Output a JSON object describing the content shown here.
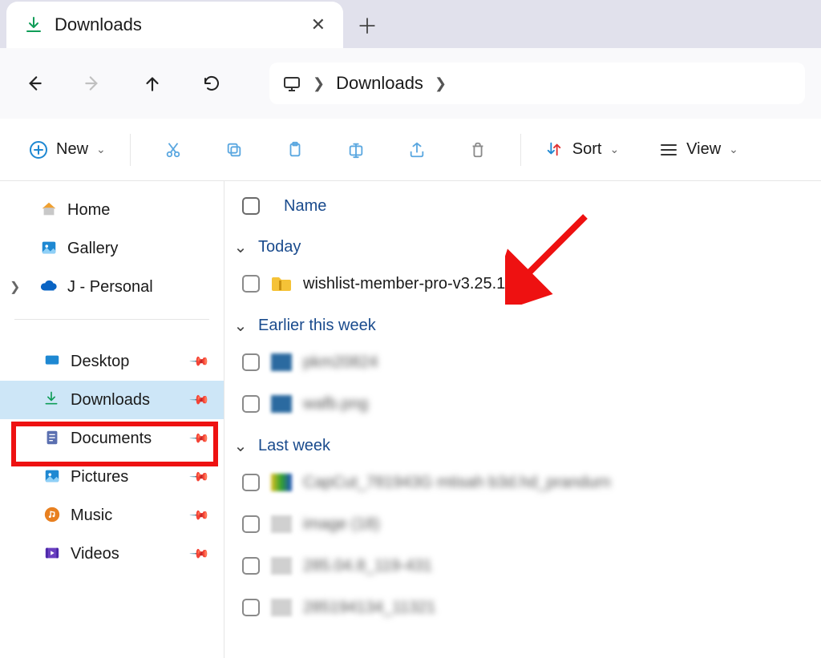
{
  "tab": {
    "title": "Downloads"
  },
  "nav": {},
  "breadcrumb": {
    "current": "Downloads"
  },
  "toolbar": {
    "new_label": "New",
    "sort_label": "Sort",
    "view_label": "View"
  },
  "sidebar": {
    "top": [
      {
        "label": "Home"
      },
      {
        "label": "Gallery"
      },
      {
        "label": "J - Personal"
      }
    ],
    "quick": [
      {
        "label": "Desktop"
      },
      {
        "label": "Downloads",
        "selected": true
      },
      {
        "label": "Documents"
      },
      {
        "label": "Pictures"
      },
      {
        "label": "Music"
      },
      {
        "label": "Videos"
      }
    ]
  },
  "columns": {
    "name": "Name"
  },
  "groups": {
    "today": {
      "label": "Today",
      "items": [
        {
          "name": "wishlist-member-pro-v3.25.1",
          "type": "folder"
        }
      ]
    },
    "earlier_week": {
      "label": "Earlier this week",
      "items": [
        {
          "name": "pkm20824",
          "blurred": true
        },
        {
          "name": "wafb.png",
          "blurred": true
        }
      ]
    },
    "last_week": {
      "label": "Last week",
      "items": [
        {
          "name": "CapCut_781943G mtisah b3d.hd_prandurn",
          "blurred": true
        },
        {
          "name": "image (18)",
          "blurred": true
        },
        {
          "name": "285.04.8_119-431",
          "blurred": true
        },
        {
          "name": "285194134_11321",
          "blurred": true
        }
      ]
    }
  }
}
